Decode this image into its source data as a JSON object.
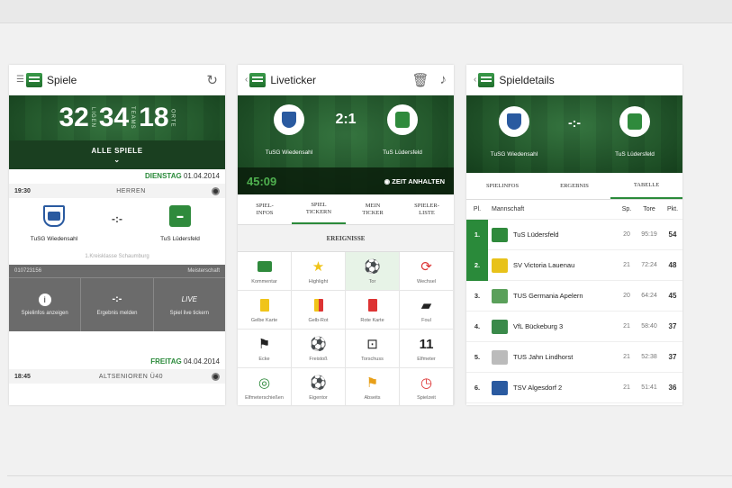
{
  "spiele": {
    "title": "Spiele",
    "stats": [
      {
        "num": "32",
        "label": "LIGEN"
      },
      {
        "num": "34",
        "label": "TEAMS"
      },
      {
        "num": "18",
        "label": "ORTE"
      }
    ],
    "all_games": "ALLE SPIELE",
    "day1": {
      "weekday": "DIENSTAG",
      "date": "01.04.2014"
    },
    "match1": {
      "time": "19:30",
      "category": "HERREN",
      "home": "TuSG Wiedensahl",
      "away": "TuS Lüdersfeld",
      "score": "-:-",
      "league": "1.Kreisklasse Schaumburg",
      "id": "010723156",
      "type": "Meisterschaft"
    },
    "actions": [
      {
        "icon": "i",
        "label": "Spielinfos anzeigen"
      },
      {
        "icon": "-:-",
        "label": "Ergebnis melden"
      },
      {
        "icon": "LIVE",
        "label": "Spiel live tickern"
      }
    ],
    "day2": {
      "weekday": "FREITAG",
      "date": "04.04.2014"
    },
    "match2": {
      "time": "18:45",
      "category": "ALTSENIOREN Ü40"
    }
  },
  "liveticker": {
    "title": "Liveticker",
    "home": "TuSG Wiedensahl",
    "away": "TuS Lüdersfeld",
    "score": "2:1",
    "timer": "45:09",
    "stop": "ZEIT ANHALTEN",
    "tabs": [
      "SPIEL-\nINFOS",
      "SPIEL\nTICKERN",
      "MEIN\nTICKER",
      "SPIELER-\nLISTE"
    ],
    "section": "EREIGNISSE",
    "events": [
      {
        "label": "Kommentar",
        "icon": "comment-icon"
      },
      {
        "label": "Highlight",
        "icon": "star-icon"
      },
      {
        "label": "Tor",
        "icon": "ball-icon"
      },
      {
        "label": "Wechsel",
        "icon": "swap-icon"
      },
      {
        "label": "Gelbe Karte",
        "icon": "yellow-card-icon"
      },
      {
        "label": "Gelb-Rot",
        "icon": "yellow-red-card-icon"
      },
      {
        "label": "Rote Karte",
        "icon": "red-card-icon"
      },
      {
        "label": "Foul",
        "icon": "boot-icon"
      },
      {
        "label": "Ecke",
        "icon": "corner-flag-icon"
      },
      {
        "label": "Freistoß",
        "icon": "free-kick-icon"
      },
      {
        "label": "Torschuss",
        "icon": "shot-icon"
      },
      {
        "label": "Elfmeter",
        "icon": "eleven-icon"
      },
      {
        "label": "Elfmeterschießen",
        "icon": "penalty-shootout-icon"
      },
      {
        "label": "Eigentor",
        "icon": "own-goal-icon"
      },
      {
        "label": "Abseits",
        "icon": "offside-flag-icon"
      },
      {
        "label": "Spielzeit",
        "icon": "clock-icon"
      }
    ]
  },
  "spieldetails": {
    "title": "Spieldetails",
    "home": "TuSG Wiedensahl",
    "away": "TuS Lüdersfeld",
    "score": "-:-",
    "tabs": [
      "SPIELINFOS",
      "ERGEBNIS",
      "TABELLE"
    ],
    "headers": {
      "pl": "Pl.",
      "team": "Mannschaft",
      "sp": "Sp.",
      "tore": "Tore",
      "pkt": "Pkt."
    },
    "rows": [
      {
        "pl": "1.",
        "team": "TuS Lüdersfeld",
        "sp": "20",
        "tore": "95:19",
        "pkt": "54",
        "color": "#2f8a3c"
      },
      {
        "pl": "2.",
        "team": "SV Victoria Lauenau",
        "sp": "21",
        "tore": "72:24",
        "pkt": "48",
        "color": "#e8c21a"
      },
      {
        "pl": "3.",
        "team": "TUS Germania Apelern",
        "sp": "20",
        "tore": "64:24",
        "pkt": "45",
        "color": "#5aa05a"
      },
      {
        "pl": "4.",
        "team": "VfL Bückeburg 3",
        "sp": "21",
        "tore": "58:40",
        "pkt": "37",
        "color": "#3a8a4a"
      },
      {
        "pl": "5.",
        "team": "TUS Jahn Lindhorst",
        "sp": "21",
        "tore": "52:38",
        "pkt": "37",
        "color": "#bbbbbb"
      },
      {
        "pl": "6.",
        "team": "TSV Algesdorf 2",
        "sp": "21",
        "tore": "51:41",
        "pkt": "36",
        "color": "#2a5aa0"
      }
    ]
  }
}
